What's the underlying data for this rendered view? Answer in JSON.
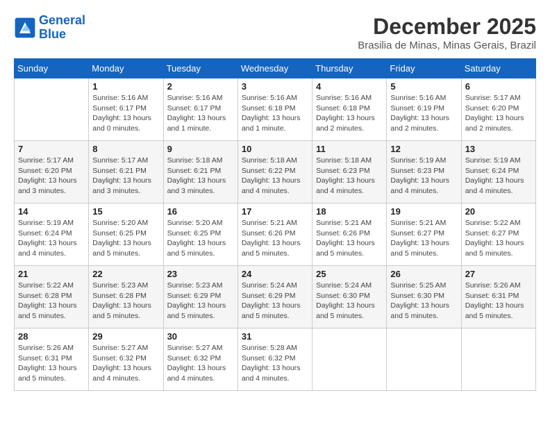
{
  "header": {
    "logo_line1": "General",
    "logo_line2": "Blue",
    "month": "December 2025",
    "location": "Brasilia de Minas, Minas Gerais, Brazil"
  },
  "weekdays": [
    "Sunday",
    "Monday",
    "Tuesday",
    "Wednesday",
    "Thursday",
    "Friday",
    "Saturday"
  ],
  "weeks": [
    [
      {
        "day": "",
        "sunrise": "",
        "sunset": "",
        "daylight": ""
      },
      {
        "day": "1",
        "sunrise": "Sunrise: 5:16 AM",
        "sunset": "Sunset: 6:17 PM",
        "daylight": "Daylight: 13 hours and 0 minutes."
      },
      {
        "day": "2",
        "sunrise": "Sunrise: 5:16 AM",
        "sunset": "Sunset: 6:17 PM",
        "daylight": "Daylight: 13 hours and 1 minute."
      },
      {
        "day": "3",
        "sunrise": "Sunrise: 5:16 AM",
        "sunset": "Sunset: 6:18 PM",
        "daylight": "Daylight: 13 hours and 1 minute."
      },
      {
        "day": "4",
        "sunrise": "Sunrise: 5:16 AM",
        "sunset": "Sunset: 6:18 PM",
        "daylight": "Daylight: 13 hours and 2 minutes."
      },
      {
        "day": "5",
        "sunrise": "Sunrise: 5:16 AM",
        "sunset": "Sunset: 6:19 PM",
        "daylight": "Daylight: 13 hours and 2 minutes."
      },
      {
        "day": "6",
        "sunrise": "Sunrise: 5:17 AM",
        "sunset": "Sunset: 6:20 PM",
        "daylight": "Daylight: 13 hours and 2 minutes."
      }
    ],
    [
      {
        "day": "7",
        "sunrise": "Sunrise: 5:17 AM",
        "sunset": "Sunset: 6:20 PM",
        "daylight": "Daylight: 13 hours and 3 minutes."
      },
      {
        "day": "8",
        "sunrise": "Sunrise: 5:17 AM",
        "sunset": "Sunset: 6:21 PM",
        "daylight": "Daylight: 13 hours and 3 minutes."
      },
      {
        "day": "9",
        "sunrise": "Sunrise: 5:18 AM",
        "sunset": "Sunset: 6:21 PM",
        "daylight": "Daylight: 13 hours and 3 minutes."
      },
      {
        "day": "10",
        "sunrise": "Sunrise: 5:18 AM",
        "sunset": "Sunset: 6:22 PM",
        "daylight": "Daylight: 13 hours and 4 minutes."
      },
      {
        "day": "11",
        "sunrise": "Sunrise: 5:18 AM",
        "sunset": "Sunset: 6:23 PM",
        "daylight": "Daylight: 13 hours and 4 minutes."
      },
      {
        "day": "12",
        "sunrise": "Sunrise: 5:19 AM",
        "sunset": "Sunset: 6:23 PM",
        "daylight": "Daylight: 13 hours and 4 minutes."
      },
      {
        "day": "13",
        "sunrise": "Sunrise: 5:19 AM",
        "sunset": "Sunset: 6:24 PM",
        "daylight": "Daylight: 13 hours and 4 minutes."
      }
    ],
    [
      {
        "day": "14",
        "sunrise": "Sunrise: 5:19 AM",
        "sunset": "Sunset: 6:24 PM",
        "daylight": "Daylight: 13 hours and 4 minutes."
      },
      {
        "day": "15",
        "sunrise": "Sunrise: 5:20 AM",
        "sunset": "Sunset: 6:25 PM",
        "daylight": "Daylight: 13 hours and 5 minutes."
      },
      {
        "day": "16",
        "sunrise": "Sunrise: 5:20 AM",
        "sunset": "Sunset: 6:25 PM",
        "daylight": "Daylight: 13 hours and 5 minutes."
      },
      {
        "day": "17",
        "sunrise": "Sunrise: 5:21 AM",
        "sunset": "Sunset: 6:26 PM",
        "daylight": "Daylight: 13 hours and 5 minutes."
      },
      {
        "day": "18",
        "sunrise": "Sunrise: 5:21 AM",
        "sunset": "Sunset: 6:26 PM",
        "daylight": "Daylight: 13 hours and 5 minutes."
      },
      {
        "day": "19",
        "sunrise": "Sunrise: 5:21 AM",
        "sunset": "Sunset: 6:27 PM",
        "daylight": "Daylight: 13 hours and 5 minutes."
      },
      {
        "day": "20",
        "sunrise": "Sunrise: 5:22 AM",
        "sunset": "Sunset: 6:27 PM",
        "daylight": "Daylight: 13 hours and 5 minutes."
      }
    ],
    [
      {
        "day": "21",
        "sunrise": "Sunrise: 5:22 AM",
        "sunset": "Sunset: 6:28 PM",
        "daylight": "Daylight: 13 hours and 5 minutes."
      },
      {
        "day": "22",
        "sunrise": "Sunrise: 5:23 AM",
        "sunset": "Sunset: 6:28 PM",
        "daylight": "Daylight: 13 hours and 5 minutes."
      },
      {
        "day": "23",
        "sunrise": "Sunrise: 5:23 AM",
        "sunset": "Sunset: 6:29 PM",
        "daylight": "Daylight: 13 hours and 5 minutes."
      },
      {
        "day": "24",
        "sunrise": "Sunrise: 5:24 AM",
        "sunset": "Sunset: 6:29 PM",
        "daylight": "Daylight: 13 hours and 5 minutes."
      },
      {
        "day": "25",
        "sunrise": "Sunrise: 5:24 AM",
        "sunset": "Sunset: 6:30 PM",
        "daylight": "Daylight: 13 hours and 5 minutes."
      },
      {
        "day": "26",
        "sunrise": "Sunrise: 5:25 AM",
        "sunset": "Sunset: 6:30 PM",
        "daylight": "Daylight: 13 hours and 5 minutes."
      },
      {
        "day": "27",
        "sunrise": "Sunrise: 5:26 AM",
        "sunset": "Sunset: 6:31 PM",
        "daylight": "Daylight: 13 hours and 5 minutes."
      }
    ],
    [
      {
        "day": "28",
        "sunrise": "Sunrise: 5:26 AM",
        "sunset": "Sunset: 6:31 PM",
        "daylight": "Daylight: 13 hours and 5 minutes."
      },
      {
        "day": "29",
        "sunrise": "Sunrise: 5:27 AM",
        "sunset": "Sunset: 6:32 PM",
        "daylight": "Daylight: 13 hours and 4 minutes."
      },
      {
        "day": "30",
        "sunrise": "Sunrise: 5:27 AM",
        "sunset": "Sunset: 6:32 PM",
        "daylight": "Daylight: 13 hours and 4 minutes."
      },
      {
        "day": "31",
        "sunrise": "Sunrise: 5:28 AM",
        "sunset": "Sunset: 6:32 PM",
        "daylight": "Daylight: 13 hours and 4 minutes."
      },
      {
        "day": "",
        "sunrise": "",
        "sunset": "",
        "daylight": ""
      },
      {
        "day": "",
        "sunrise": "",
        "sunset": "",
        "daylight": ""
      },
      {
        "day": "",
        "sunrise": "",
        "sunset": "",
        "daylight": ""
      }
    ]
  ]
}
